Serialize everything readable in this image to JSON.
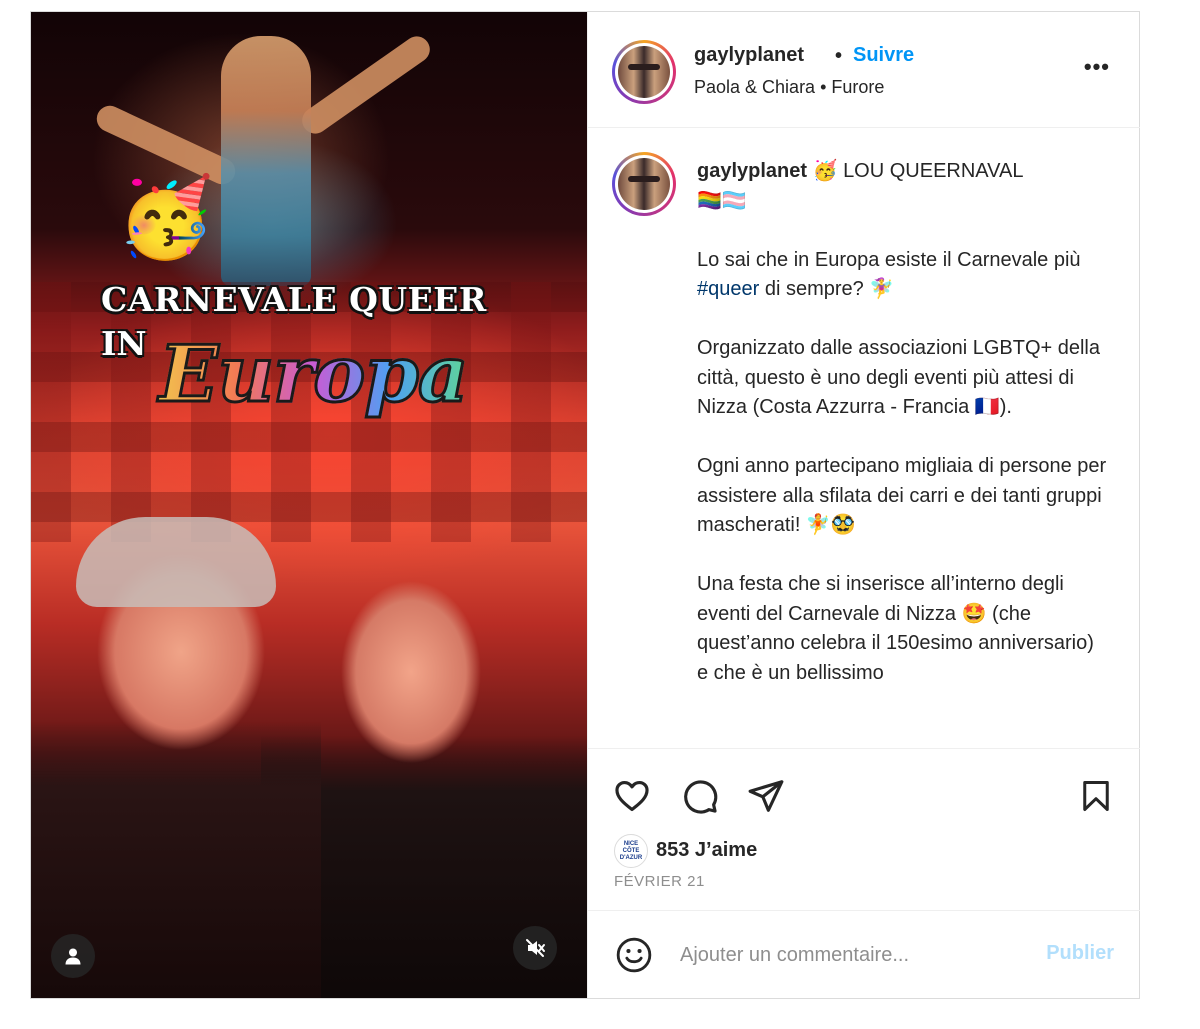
{
  "post": {
    "author": "gaylyplanet",
    "follow_label": "Suivre",
    "audio": "Paola & Chiara • Furore",
    "more_label": "•••"
  },
  "media": {
    "sticker_emoji": "🥳",
    "sticker_title": "CARNEVALE QUEER",
    "sticker_in": "IN",
    "sticker_europa": "Europa",
    "user_icon": "user-icon",
    "mute_icon": "muted-speaker-icon"
  },
  "caption": {
    "author": "gaylyplanet",
    "title": " 🥳 LOU QUEERNAVAL",
    "flags": "🏳️‍🌈🏳️‍⚧️",
    "p2_a": "Lo sai che in Europa esiste il Carnevale più ",
    "hashtag": "#queer",
    "p2_b": " di sempre? 🧚‍♀️",
    "p3": "Organizzato dalle associazioni LGBTQ+ della città, questo è uno degli eventi più attesi di Nizza (Costa Azzurra - Francia 🇫🇷).",
    "p4": "Ogni anno partecipano migliaia di persone per assistere alla sfilata dei carri e dei tanti gruppi mascherati! 🧚🥸",
    "p5": "Una festa che si inserisce all’interno degli eventi del Carnevale di Nizza 🤩 (che quest’anno celebra il 150esimo anniversario) e che è un bellissimo"
  },
  "actions": {
    "like_icon": "heart-icon",
    "comment_icon": "comment-icon",
    "share_icon": "paper-plane-icon",
    "save_icon": "bookmark-icon",
    "likes_avatar_text": "NICE CÔTE D'AZUR",
    "likes": "853 J’aime",
    "date": "FÉVRIER 21"
  },
  "comment": {
    "emoji_icon": "smiley-icon",
    "placeholder": "Ajouter un commentaire...",
    "publish_label": "Publier"
  },
  "colors": {
    "link_blue": "#0095f6",
    "publish_disabled": "#b2dffc",
    "hashtag": "#00376b",
    "text": "#262626",
    "muted": "#8e8e8e"
  }
}
